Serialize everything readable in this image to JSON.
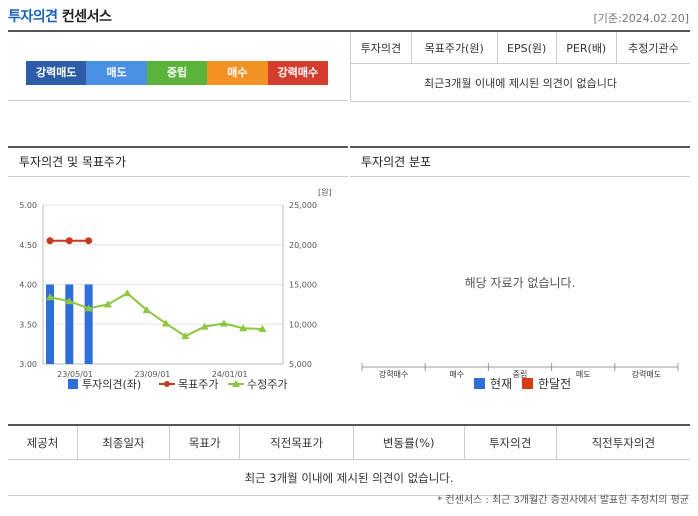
{
  "header": {
    "title_part1": "투자의견",
    "title_part2": "컨센서스",
    "date_ref": "[기준:2024.02.20]"
  },
  "rating_scale": [
    {
      "label": "강력매도",
      "color": "#2d5ca8"
    },
    {
      "label": "매도",
      "color": "#4a90e2"
    },
    {
      "label": "중립",
      "color": "#5cb33b"
    },
    {
      "label": "매수",
      "color": "#f39223"
    },
    {
      "label": "강력매수",
      "color": "#d43c2e"
    }
  ],
  "opinion_table": {
    "headers": [
      "투자의견",
      "목표주가(원)",
      "EPS(원)",
      "PER(배)",
      "추정기관수"
    ],
    "empty_message": "최근3개월 이내에 제시된 의견이 없습니다"
  },
  "left_panel": {
    "title": "투자의견 및 목표주가"
  },
  "right_panel": {
    "title": "투자의견 분포",
    "no_data": "해당 자료가 없습니다."
  },
  "chart_data": [
    {
      "type": "line",
      "title": "투자의견 및 목표주가",
      "y_left": {
        "min": 3.0,
        "max": 5.0,
        "ticks": [
          "5.00",
          "4.50",
          "4.00",
          "3.50",
          "3.00"
        ]
      },
      "y_right": {
        "unit": "[원]",
        "min": 5000,
        "max": 25000,
        "ticks": [
          "25,000",
          "20,000",
          "15,000",
          "10,000",
          "5,000"
        ]
      },
      "x_ticks": [
        {
          "t": 1.3,
          "label": "23/05/01"
        },
        {
          "t": 5.3,
          "label": "23/09/01"
        },
        {
          "t": 9.3,
          "label": "24/01/01"
        }
      ],
      "series": [
        {
          "name": "투자의견(좌)",
          "kind": "bar",
          "color": "#2d6fd6",
          "points": [
            [
              0,
              4.0
            ],
            [
              1,
              4.0
            ],
            [
              2,
              4.0
            ]
          ]
        },
        {
          "name": "목표주가",
          "kind": "line",
          "color": "#c9391f",
          "points": [
            [
              0,
              20500
            ],
            [
              1,
              20500
            ],
            [
              2,
              20500
            ]
          ]
        },
        {
          "name": "수정주가",
          "kind": "line",
          "color": "#8dc63f",
          "points": [
            [
              0,
              13400
            ],
            [
              1,
              12900
            ],
            [
              2,
              12000
            ],
            [
              3,
              12500
            ],
            [
              4,
              13900
            ],
            [
              5,
              11800
            ],
            [
              6,
              10100
            ],
            [
              7,
              8500
            ],
            [
              8,
              9700
            ],
            [
              9,
              10100
            ],
            [
              10,
              9500
            ],
            [
              11,
              9400
            ]
          ]
        }
      ],
      "legend": "bottom"
    },
    {
      "type": "bar",
      "title": "투자의견 분포",
      "categories": [
        "강력매수",
        "매수",
        "중립",
        "매도",
        "강력매도"
      ],
      "series": [
        {
          "name": "현재",
          "color": "#2d6fd6",
          "values": []
        },
        {
          "name": "한달전",
          "color": "#d43c14",
          "values": []
        }
      ],
      "legend": "bottom"
    }
  ],
  "bottom_table": {
    "headers": [
      "제공처",
      "최종일자",
      "목표가",
      "직전목표가",
      "변동률(%)",
      "투자의견",
      "직전투자의견"
    ],
    "empty_message": "최근 3개월 이내에 제시된 의견이 없습니다."
  },
  "footnote": "* 컨센서스 : 최근 3개월간 증권사에서 발표한 추정치의 평균"
}
